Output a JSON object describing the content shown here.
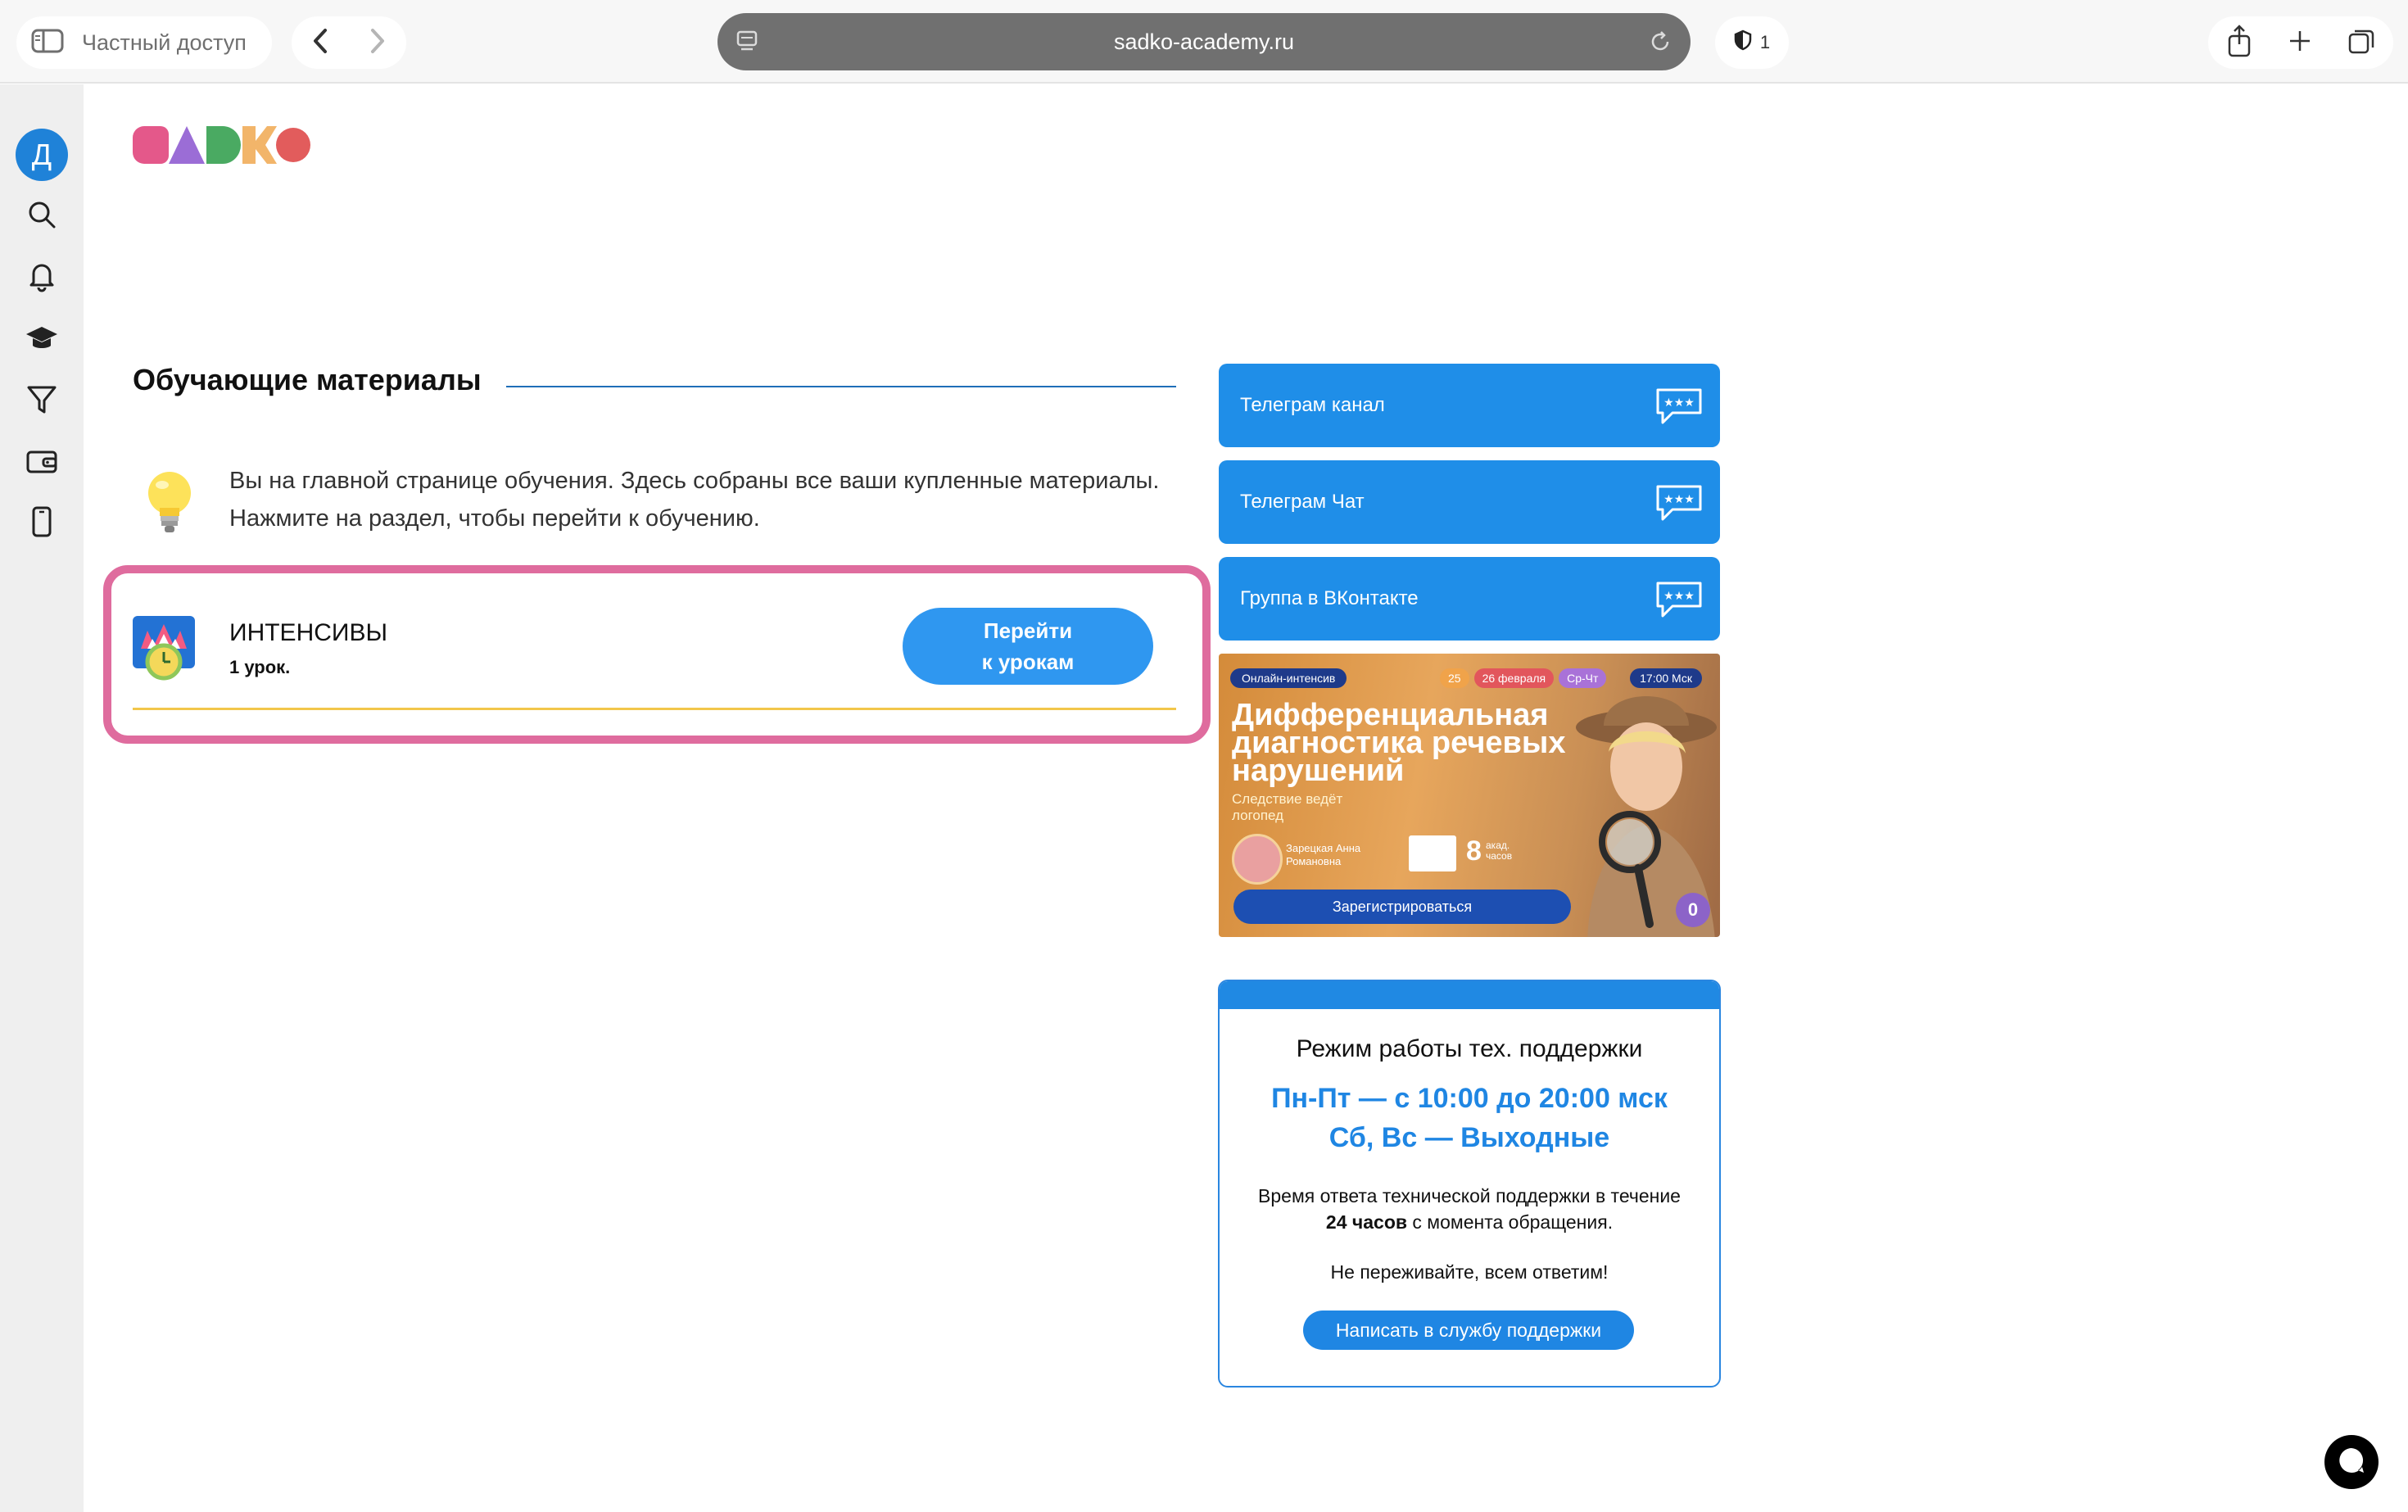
{
  "browser": {
    "private_label": "Частный доступ",
    "url": "sadko-academy.ru",
    "shield_count": "1"
  },
  "sidebar": {
    "avatar_letter": "Д",
    "items": [
      {
        "icon": "search-icon"
      },
      {
        "icon": "bell-icon"
      },
      {
        "icon": "graduation-cap-icon"
      },
      {
        "icon": "funnel-icon"
      },
      {
        "icon": "wallet-icon"
      },
      {
        "icon": "phone-icon"
      }
    ]
  },
  "brand": {
    "logo_colors": [
      "#e4588a",
      "#9b6dd6",
      "#4aaa62",
      "#f2b56a",
      "#e25c5c"
    ]
  },
  "main": {
    "section_title": "Обучающие материалы",
    "intro": "Вы на главной странице обучения. Здесь собраны все ваши купленные материалы. Нажмите на раздел, чтобы перейти к обучению.",
    "course": {
      "title": "ИНТЕНСИВЫ",
      "lessons": "1 урок.",
      "button_line1": "Перейти",
      "button_line2": "к урокам"
    }
  },
  "right": {
    "social": [
      {
        "label": "Телеграм канал"
      },
      {
        "label": "Телеграм Чат"
      },
      {
        "label": "Группа в ВКонтакте"
      }
    ],
    "banner": {
      "tag": "Онлайн-интенсив",
      "date_day1": "25",
      "date_day2": "26 февраля",
      "date_week": "Ср-Чт",
      "time": "17:00 Мск",
      "headline": "Дифференциальная диагностика речевых нарушений",
      "subline": "Следствие ведёт логопед",
      "author": "Зарецкая Анна Романовна",
      "hours_num": "8",
      "hours_label": "акад. часов",
      "register": "Зарегистрироваться",
      "badge": "0"
    },
    "support": {
      "title": "Режим работы тех. поддержки",
      "weekdays": "Пн-Пт — с 10:00 до 20:00 мск",
      "weekend": "Сб, Вс — Выходные",
      "response_pre": "Время ответа технической поддержки в течение",
      "response_bold": "24 часов",
      "response_post": "с момента обращения.",
      "calm": "Не переживайте, всем ответим!",
      "button": "Написать в службу поддержки"
    }
  },
  "colors": {
    "accent_blue": "#1f8ee8",
    "highlight_pink": "#df6c9e",
    "divider_yellow": "#f2c64a"
  }
}
